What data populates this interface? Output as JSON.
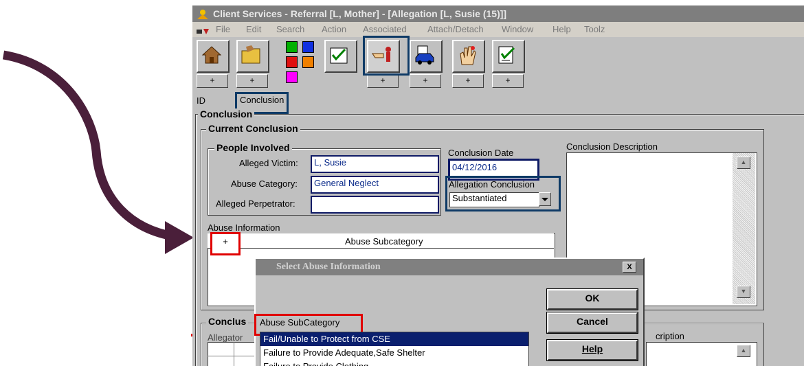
{
  "window": {
    "title": "Client Services - Referral [L, Mother] - [Allegation [L, Susie (15)]]"
  },
  "menu": [
    "File",
    "Edit",
    "Search",
    "Action",
    "Associated",
    "Attach/Detach",
    "Window",
    "Help",
    "Toolz"
  ],
  "toolbar": {
    "plus_label": "+"
  },
  "tabs": {
    "id": "ID",
    "conclusion": "Conclusion"
  },
  "conclusion": {
    "section_title": "Conclusion",
    "current_title": "Current Conclusion",
    "people_title": "People Involved",
    "alleged_victim_label": "Alleged Victim:",
    "alleged_victim_value": "L, Susie",
    "abuse_category_label": "Abuse Category:",
    "abuse_category_value": "General Neglect",
    "alleged_perpetrator_label": "Alleged Perpetrator:",
    "alleged_perpetrator_value": "",
    "conclusion_date_label": "Conclusion Date",
    "conclusion_date_value": "04/12/2016",
    "allegation_conclusion_label": "Allegation Conclusion",
    "allegation_conclusion_value": "Substantiated",
    "description_label": "Conclusion Description",
    "abuse_info_label": "Abuse Information",
    "abuse_info_add": "+",
    "abuse_subcategory_header": "Abuse Subcategory",
    "lower_group_title": "Conclus",
    "lower_allegation_label": "Allegator",
    "lower_description_label": "cription"
  },
  "dialog": {
    "title": "Select Abuse Information",
    "close": "X",
    "ok": "OK",
    "cancel": "Cancel",
    "help": "Help",
    "list_label": "Abuse SubCategory",
    "items": [
      "Fail/Unable to Protect from CSE",
      "Failure to Provide Adequate,Safe Shelter",
      "Failure to Provide Clothing"
    ],
    "selected_index": 0
  },
  "colors": {
    "annotation_arrow": "#4a1f3a",
    "highlight_blue": "#0e3a66",
    "highlight_red": "#e00000",
    "selection": "#0a1f6e"
  }
}
